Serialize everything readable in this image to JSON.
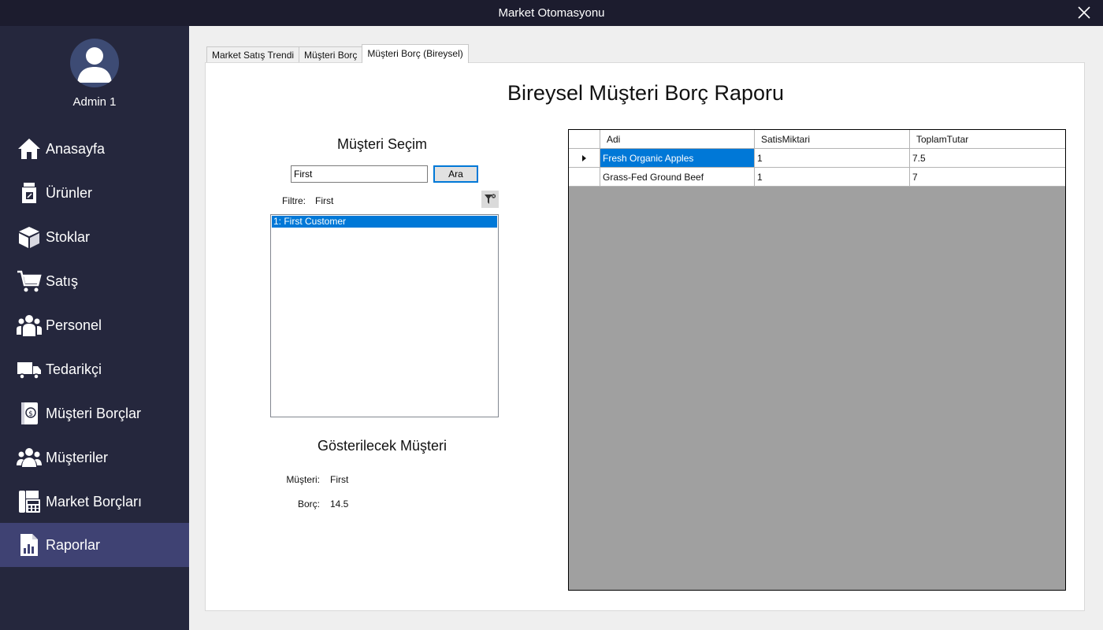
{
  "window": {
    "title": "Market Otomasyonu"
  },
  "sidebar": {
    "admin_name": "Admin 1",
    "items": [
      {
        "label": "Anasayfa",
        "icon": "home-icon"
      },
      {
        "label": "Ürünler",
        "icon": "product-box-icon"
      },
      {
        "label": "Stoklar",
        "icon": "boxes-icon"
      },
      {
        "label": "Satış",
        "icon": "cart-icon"
      },
      {
        "label": "Personel",
        "icon": "people-icon"
      },
      {
        "label": "Tedarikçi",
        "icon": "truck-icon"
      },
      {
        "label": "Müşteri Borçlar",
        "icon": "money-book-icon"
      },
      {
        "label": "Müşteriler",
        "icon": "users-icon"
      },
      {
        "label": "Market Borçları",
        "icon": "fax-calculator-icon"
      },
      {
        "label": "Raporlar",
        "icon": "report-chart-icon",
        "active": true
      }
    ],
    "colors": {
      "background": "#25273d",
      "active": "#3f4273"
    }
  },
  "tabs": [
    {
      "label": "Market Satış Trendi"
    },
    {
      "label": "Müşteri Borç"
    },
    {
      "label": "Müşteri Borç (Bireysel)",
      "active": true
    }
  ],
  "report": {
    "title": "Bireysel Müşteri Borç Raporu",
    "selection": {
      "title": "Müşteri Seçim",
      "search_value": "First",
      "search_button": "Ara",
      "filter_label": "Filtre:",
      "filter_value": "First",
      "list_items": [
        "1: First Customer"
      ]
    },
    "display": {
      "title": "Gösterilecek Müşteri",
      "customer_label": "Müşteri:",
      "customer_value": "First",
      "debt_label": "Borç:",
      "debt_value": "14.5"
    },
    "grid": {
      "columns": [
        "Adi",
        "SatisMiktari",
        "ToplamTutar"
      ],
      "rows": [
        [
          "Fresh Organic Apples",
          "1",
          "7.5"
        ],
        [
          "Grass-Fed Ground Beef",
          "1",
          "7"
        ]
      ]
    }
  },
  "colors": {
    "accent": "#0078d7",
    "titlebar": "#1c1c2e"
  }
}
